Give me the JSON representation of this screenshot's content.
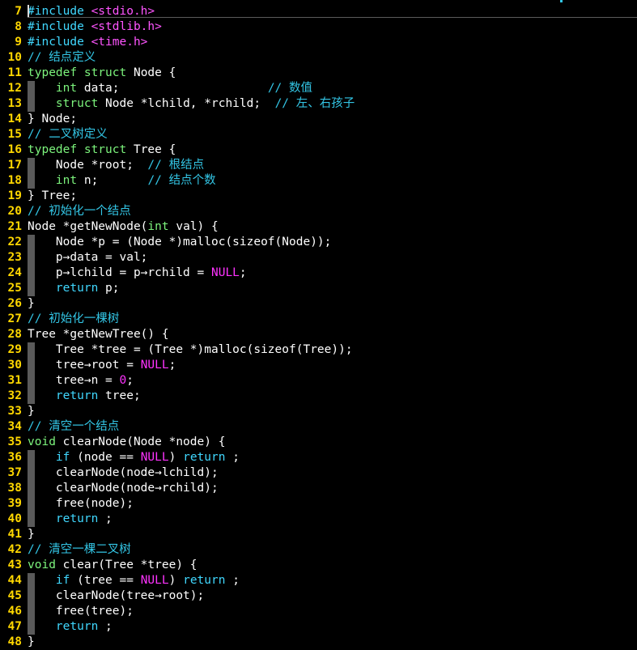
{
  "colors": {
    "background": "#000000",
    "line_number": "#ffd700",
    "comment": "#33c6e6",
    "keyword": "#40d8ff",
    "type": "#7cf37c",
    "string": "#ff55ff",
    "constant": "#ff33ff",
    "text": "#ffffff"
  },
  "lines": [
    {
      "n": "7",
      "fold": false,
      "tokens": [
        {
          "t": "#include",
          "c": "pre"
        },
        {
          "t": " ",
          "c": "plain"
        },
        {
          "t": "<stdio.h>",
          "c": "str"
        }
      ]
    },
    {
      "n": "8",
      "fold": false,
      "tokens": [
        {
          "t": "#include",
          "c": "pre"
        },
        {
          "t": " ",
          "c": "plain"
        },
        {
          "t": "<stdlib.h>",
          "c": "str"
        }
      ]
    },
    {
      "n": "9",
      "fold": false,
      "tokens": [
        {
          "t": "#include",
          "c": "pre"
        },
        {
          "t": " ",
          "c": "plain"
        },
        {
          "t": "<time.h>",
          "c": "str"
        }
      ]
    },
    {
      "n": "10",
      "fold": false,
      "tokens": [
        {
          "t": "// 结点定义",
          "c": "comment"
        }
      ]
    },
    {
      "n": "11",
      "fold": false,
      "tokens": [
        {
          "t": "typedef",
          "c": "type"
        },
        {
          "t": " ",
          "c": "plain"
        },
        {
          "t": "struct",
          "c": "type"
        },
        {
          "t": " Node {",
          "c": "plain"
        }
      ]
    },
    {
      "n": "12",
      "fold": true,
      "tokens": [
        {
          "t": "    ",
          "c": "plain"
        },
        {
          "t": "int",
          "c": "type"
        },
        {
          "t": " data;                     ",
          "c": "plain"
        },
        {
          "t": "// 数值",
          "c": "comment"
        }
      ]
    },
    {
      "n": "13",
      "fold": true,
      "tokens": [
        {
          "t": "    ",
          "c": "plain"
        },
        {
          "t": "struct",
          "c": "type"
        },
        {
          "t": " Node *lchild, *rchild;  ",
          "c": "plain"
        },
        {
          "t": "// 左、右孩子",
          "c": "comment"
        }
      ]
    },
    {
      "n": "14",
      "fold": false,
      "tokens": [
        {
          "t": "} Node;",
          "c": "plain"
        }
      ]
    },
    {
      "n": "15",
      "fold": false,
      "tokens": [
        {
          "t": "// 二叉树定义",
          "c": "comment"
        }
      ]
    },
    {
      "n": "16",
      "fold": false,
      "tokens": [
        {
          "t": "typedef",
          "c": "type"
        },
        {
          "t": " ",
          "c": "plain"
        },
        {
          "t": "struct",
          "c": "type"
        },
        {
          "t": " Tree {",
          "c": "plain"
        }
      ]
    },
    {
      "n": "17",
      "fold": true,
      "tokens": [
        {
          "t": "    Node *root;  ",
          "c": "plain"
        },
        {
          "t": "// 根结点",
          "c": "comment"
        }
      ]
    },
    {
      "n": "18",
      "fold": true,
      "tokens": [
        {
          "t": "    ",
          "c": "plain"
        },
        {
          "t": "int",
          "c": "type"
        },
        {
          "t": " n;       ",
          "c": "plain"
        },
        {
          "t": "// 结点个数",
          "c": "comment"
        }
      ]
    },
    {
      "n": "19",
      "fold": false,
      "tokens": [
        {
          "t": "} Tree;",
          "c": "plain"
        }
      ]
    },
    {
      "n": "20",
      "fold": false,
      "tokens": [
        {
          "t": "// 初始化一个结点",
          "c": "comment"
        }
      ]
    },
    {
      "n": "21",
      "fold": false,
      "tokens": [
        {
          "t": "Node *getNewNode(",
          "c": "plain"
        },
        {
          "t": "int",
          "c": "type"
        },
        {
          "t": " val) {",
          "c": "plain"
        }
      ]
    },
    {
      "n": "22",
      "fold": true,
      "tokens": [
        {
          "t": "    Node *p = (Node *)malloc(sizeof(Node));",
          "c": "plain"
        }
      ]
    },
    {
      "n": "23",
      "fold": true,
      "tokens": [
        {
          "t": "    p→data = val;",
          "c": "plain"
        }
      ]
    },
    {
      "n": "24",
      "fold": true,
      "tokens": [
        {
          "t": "    p→lchild = p→rchild = ",
          "c": "plain"
        },
        {
          "t": "NULL",
          "c": "const"
        },
        {
          "t": ";",
          "c": "plain"
        }
      ]
    },
    {
      "n": "25",
      "fold": true,
      "tokens": [
        {
          "t": "    ",
          "c": "plain"
        },
        {
          "t": "return",
          "c": "kw"
        },
        {
          "t": " p;",
          "c": "plain"
        }
      ]
    },
    {
      "n": "26",
      "fold": false,
      "tokens": [
        {
          "t": "}",
          "c": "plain"
        }
      ]
    },
    {
      "n": "27",
      "fold": false,
      "tokens": [
        {
          "t": "// 初始化一棵树",
          "c": "comment"
        }
      ]
    },
    {
      "n": "28",
      "fold": false,
      "tokens": [
        {
          "t": "Tree *getNewTree() {",
          "c": "plain"
        }
      ]
    },
    {
      "n": "29",
      "fold": true,
      "tokens": [
        {
          "t": "    Tree *tree = (Tree *)malloc(sizeof(Tree));",
          "c": "plain"
        }
      ]
    },
    {
      "n": "30",
      "fold": true,
      "tokens": [
        {
          "t": "    tree→root = ",
          "c": "plain"
        },
        {
          "t": "NULL",
          "c": "const"
        },
        {
          "t": ";",
          "c": "plain"
        }
      ]
    },
    {
      "n": "31",
      "fold": true,
      "tokens": [
        {
          "t": "    tree→n = ",
          "c": "plain"
        },
        {
          "t": "0",
          "c": "const"
        },
        {
          "t": ";",
          "c": "plain"
        }
      ]
    },
    {
      "n": "32",
      "fold": true,
      "tokens": [
        {
          "t": "    ",
          "c": "plain"
        },
        {
          "t": "return",
          "c": "kw"
        },
        {
          "t": " tree;",
          "c": "plain"
        }
      ]
    },
    {
      "n": "33",
      "fold": false,
      "tokens": [
        {
          "t": "}",
          "c": "plain"
        }
      ]
    },
    {
      "n": "34",
      "fold": false,
      "tokens": [
        {
          "t": "// 清空一个结点",
          "c": "comment"
        }
      ]
    },
    {
      "n": "35",
      "fold": false,
      "tokens": [
        {
          "t": "void",
          "c": "type"
        },
        {
          "t": " clearNode(Node *node) {",
          "c": "plain"
        }
      ]
    },
    {
      "n": "36",
      "fold": true,
      "tokens": [
        {
          "t": "    ",
          "c": "plain"
        },
        {
          "t": "if",
          "c": "kw"
        },
        {
          "t": " (node == ",
          "c": "plain"
        },
        {
          "t": "NULL",
          "c": "const"
        },
        {
          "t": ") ",
          "c": "plain"
        },
        {
          "t": "return",
          "c": "kw"
        },
        {
          "t": " ;",
          "c": "plain"
        }
      ]
    },
    {
      "n": "37",
      "fold": true,
      "tokens": [
        {
          "t": "    clearNode(node→lchild);",
          "c": "plain"
        }
      ]
    },
    {
      "n": "38",
      "fold": true,
      "tokens": [
        {
          "t": "    clearNode(node→rchild);",
          "c": "plain"
        }
      ]
    },
    {
      "n": "39",
      "fold": true,
      "tokens": [
        {
          "t": "    free(node);",
          "c": "plain"
        }
      ]
    },
    {
      "n": "40",
      "fold": true,
      "tokens": [
        {
          "t": "    ",
          "c": "plain"
        },
        {
          "t": "return",
          "c": "kw"
        },
        {
          "t": " ;",
          "c": "plain"
        }
      ]
    },
    {
      "n": "41",
      "fold": false,
      "tokens": [
        {
          "t": "}",
          "c": "plain"
        }
      ]
    },
    {
      "n": "42",
      "fold": false,
      "tokens": [
        {
          "t": "// 清空一棵二叉树",
          "c": "comment"
        }
      ]
    },
    {
      "n": "43",
      "fold": false,
      "tokens": [
        {
          "t": "void",
          "c": "type"
        },
        {
          "t": " clear(Tree *tree) {",
          "c": "plain"
        }
      ]
    },
    {
      "n": "44",
      "fold": true,
      "tokens": [
        {
          "t": "    ",
          "c": "plain"
        },
        {
          "t": "if",
          "c": "kw"
        },
        {
          "t": " (tree == ",
          "c": "plain"
        },
        {
          "t": "NULL",
          "c": "const"
        },
        {
          "t": ") ",
          "c": "plain"
        },
        {
          "t": "return",
          "c": "kw"
        },
        {
          "t": " ;",
          "c": "plain"
        }
      ]
    },
    {
      "n": "45",
      "fold": true,
      "tokens": [
        {
          "t": "    clearNode(tree→root);",
          "c": "plain"
        }
      ]
    },
    {
      "n": "46",
      "fold": true,
      "tokens": [
        {
          "t": "    free(tree);",
          "c": "plain"
        }
      ]
    },
    {
      "n": "47",
      "fold": true,
      "tokens": [
        {
          "t": "    ",
          "c": "plain"
        },
        {
          "t": "return",
          "c": "kw"
        },
        {
          "t": " ;",
          "c": "plain"
        }
      ]
    },
    {
      "n": "48",
      "fold": false,
      "tokens": [
        {
          "t": "}",
          "c": "plain"
        }
      ]
    }
  ]
}
